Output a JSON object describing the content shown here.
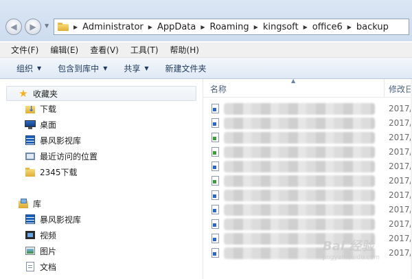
{
  "address_bar": {
    "breadcrumbs": [
      "Administrator",
      "AppData",
      "Roaming",
      "kingsoft",
      "office6",
      "backup"
    ]
  },
  "menu": [
    "文件(F)",
    "编辑(E)",
    "查看(V)",
    "工具(T)",
    "帮助(H)"
  ],
  "toolbar": {
    "organize": "组织",
    "include_in_library": "包含到库中",
    "share": "共享",
    "new_folder": "新建文件夹"
  },
  "navigation": {
    "favorites_label": "收藏夹",
    "favorites": [
      {
        "label": "下载",
        "icon": "downloads-folder-icon"
      },
      {
        "label": "桌面",
        "icon": "desktop-icon"
      },
      {
        "label": "暴风影视库",
        "icon": "media-library-icon"
      },
      {
        "label": "最近访问的位置",
        "icon": "recent-places-icon"
      },
      {
        "label": "2345下载",
        "icon": "folder-icon"
      }
    ],
    "libraries_label": "库",
    "libraries": [
      {
        "label": "暴风影视库",
        "icon": "media-library-icon"
      },
      {
        "label": "视频",
        "icon": "video-icon"
      },
      {
        "label": "图片",
        "icon": "pictures-icon"
      },
      {
        "label": "文档",
        "icon": "documents-icon"
      }
    ]
  },
  "file_list": {
    "columns": {
      "name": "名称",
      "modified": "修改日"
    },
    "rows": [
      {
        "date": "2017/",
        "icon": "word-doc-icon"
      },
      {
        "date": "2017/",
        "icon": "word-doc-icon"
      },
      {
        "date": "2017/",
        "icon": "excel-doc-icon"
      },
      {
        "date": "2017/",
        "icon": "excel-doc-icon"
      },
      {
        "date": "2017/",
        "icon": "word-doc-icon"
      },
      {
        "date": "2017/",
        "icon": "excel-doc-icon"
      },
      {
        "date": "2017/",
        "icon": "word-doc-icon"
      },
      {
        "date": "2017/",
        "icon": "word-doc-icon"
      },
      {
        "date": "2017/",
        "icon": "word-doc-icon"
      },
      {
        "date": "2017/",
        "icon": "word-doc-icon"
      },
      {
        "date": "2017/",
        "icon": "word-doc-icon"
      }
    ]
  },
  "watermark": {
    "main": "Bai 经验",
    "sub": "jingyan.baidu.com"
  }
}
